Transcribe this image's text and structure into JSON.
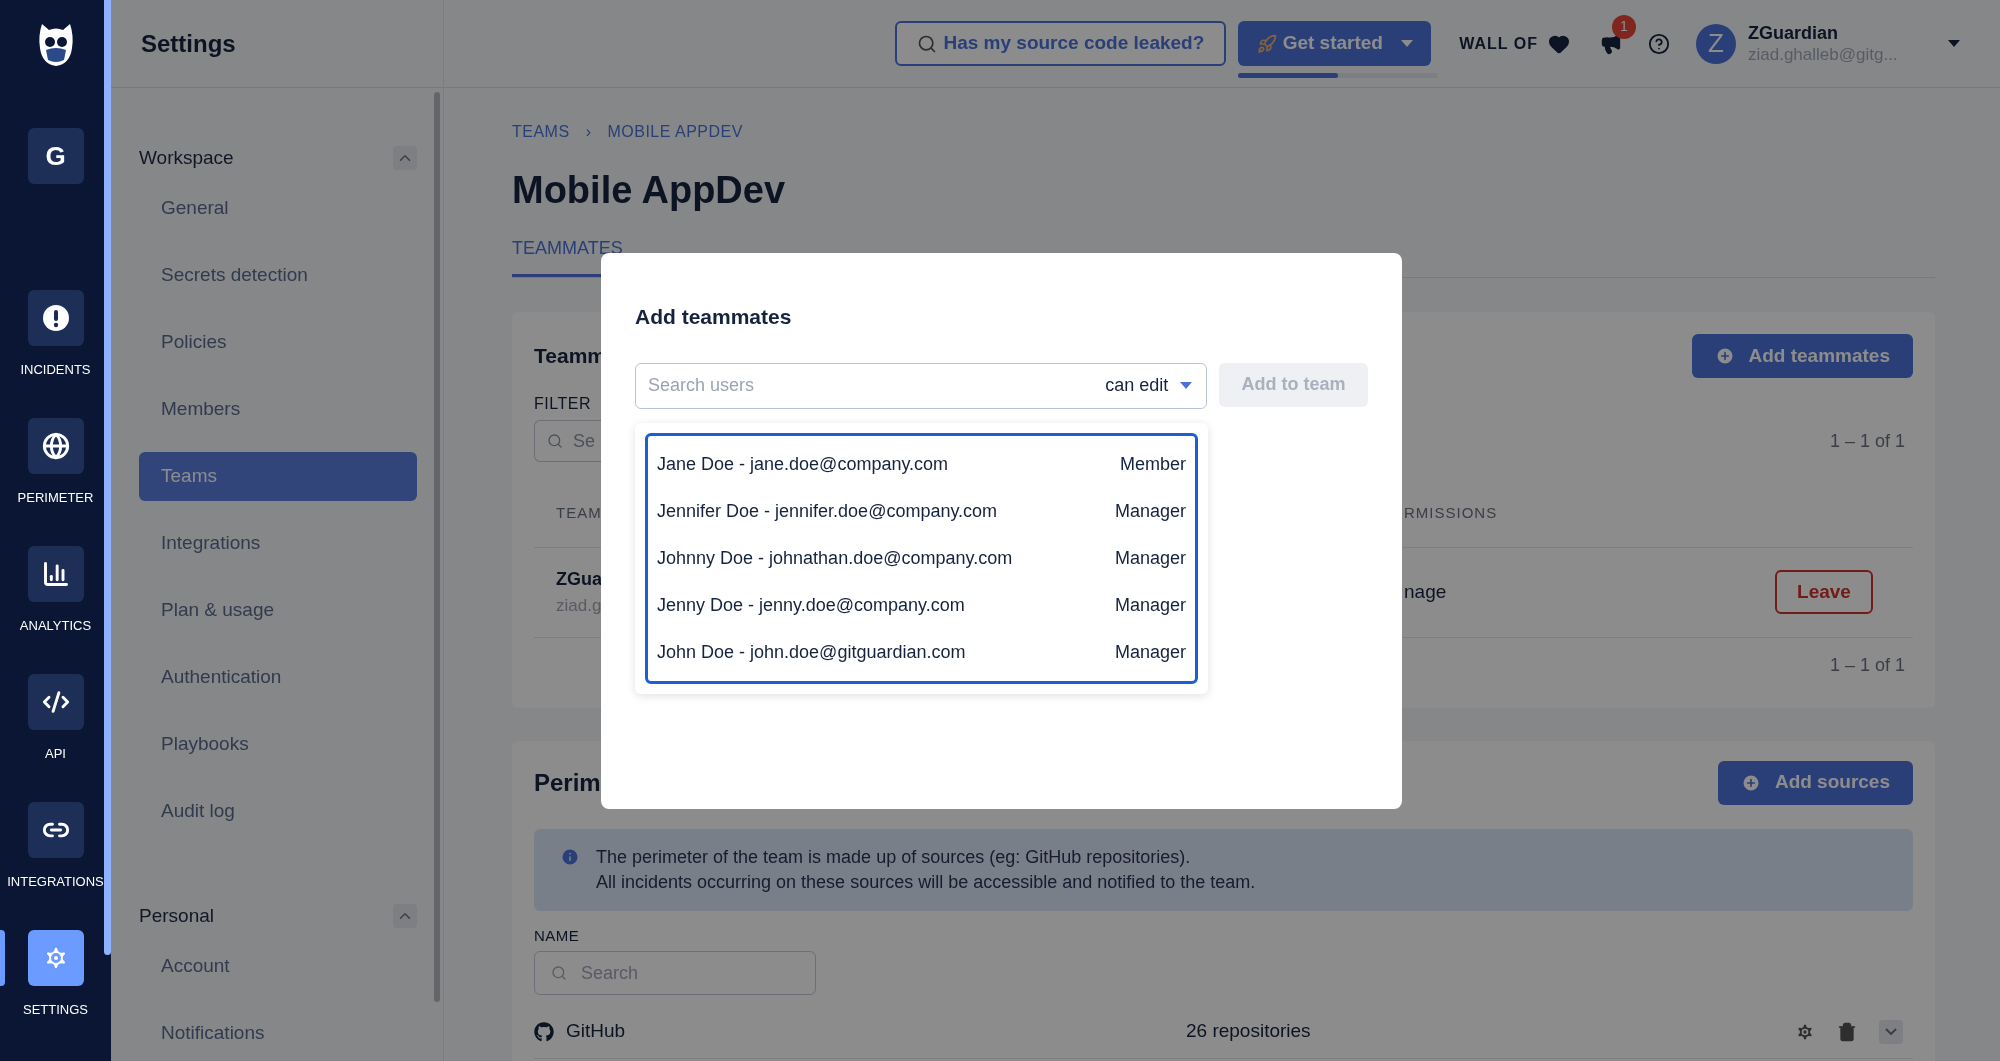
{
  "rail": {
    "workspace_initial": "G",
    "items": [
      {
        "label": "INCIDENTS",
        "kind": "incidents",
        "selected": false
      },
      {
        "label": "PERIMETER",
        "kind": "perimeter",
        "selected": false
      },
      {
        "label": "ANALYTICS",
        "kind": "analytics",
        "selected": false
      },
      {
        "label": "API",
        "kind": "api",
        "selected": false
      },
      {
        "label": "INTEGRATIONS",
        "kind": "integrations",
        "selected": false
      },
      {
        "label": "SETTINGS",
        "kind": "settings",
        "selected": true
      }
    ]
  },
  "header": {
    "title": "Settings",
    "leak_button": "Has my source code leaked?",
    "get_started": {
      "label": "Get started",
      "level": 0.5
    },
    "wall_of": "WALL OF",
    "notification_count": "1",
    "user": {
      "initial": "Z",
      "name": "ZGuardian",
      "email": "ziad.ghalleb@gitg..."
    }
  },
  "settings_nav": [
    {
      "title": "Workspace",
      "expanded": true,
      "items": [
        {
          "label": "General",
          "selected": false
        },
        {
          "label": "Secrets detection",
          "selected": false
        },
        {
          "label": "Policies",
          "selected": false
        },
        {
          "label": "Members",
          "selected": false
        },
        {
          "label": "Teams",
          "selected": true
        },
        {
          "label": "Integrations",
          "selected": false
        },
        {
          "label": "Plan & usage",
          "selected": false
        },
        {
          "label": "Authentication",
          "selected": false
        },
        {
          "label": "Playbooks",
          "selected": false
        },
        {
          "label": "Audit log",
          "selected": false
        }
      ]
    },
    {
      "title": "Personal",
      "expanded": true,
      "items": [
        {
          "label": "Account",
          "selected": false
        },
        {
          "label": "Notifications",
          "selected": false
        }
      ]
    }
  ],
  "breadcrumb": {
    "items": [
      "TEAMS",
      "MOBILE APPDEV"
    ],
    "separator": "›"
  },
  "page_title": "Mobile AppDev",
  "tabs": [
    {
      "label": "TEAMMATES",
      "selected": true
    }
  ],
  "teammates_card": {
    "title": "Teamm",
    "add_button": "Add teammates",
    "filter_label": "FILTER",
    "filter_placeholder": "Se",
    "pagination_top": "1 – 1 of 1",
    "columns": [
      "TEAM",
      "RMISSIONS"
    ],
    "rows": [
      {
        "name": "ZGua",
        "email": "ziad.g",
        "permission": "nage",
        "action": "Leave"
      }
    ],
    "pagination_bottom": "1 – 1 of 1"
  },
  "perimeter_card": {
    "title": "Perim",
    "add_button": "Add sources",
    "info": [
      "The perimeter of the team is made up of sources (eg: GitHub repositories).",
      "All incidents occurring on these sources will be accessible and notified to the team."
    ],
    "name_label": "NAME",
    "search_placeholder": "Search",
    "sources": [
      {
        "name": "GitHub",
        "count": "26 repositories"
      }
    ]
  },
  "modal": {
    "title": "Add teammates",
    "search_placeholder": "Search users",
    "permission": "can edit",
    "submit": "Add to team",
    "submit_disabled": true,
    "results": [
      {
        "label": "Jane Doe - jane.doe@company.com",
        "role": "Member"
      },
      {
        "label": "Jennifer Doe - jennifer.doe@company.com",
        "role": "Manager"
      },
      {
        "label": "Johnny Doe - johnathan.doe@company.com",
        "role": "Manager"
      },
      {
        "label": "Jenny Doe - jenny.doe@company.com",
        "role": "Manager"
      },
      {
        "label": "John Doe - john.doe@gitguardian.com",
        "role": "Manager"
      }
    ]
  }
}
